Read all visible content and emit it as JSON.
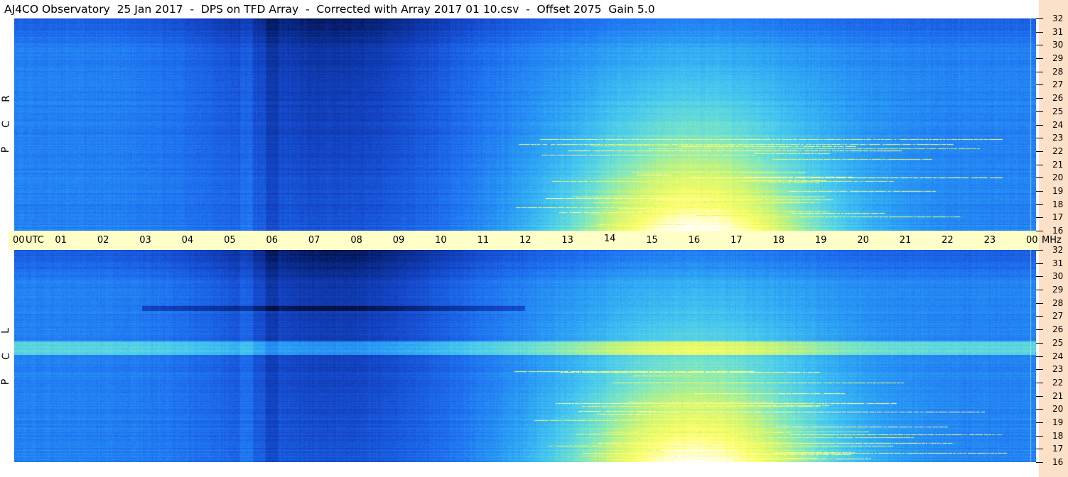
{
  "title": "AJ4CO Observatory  25 Jan 2017  -  DPS on TFD Array  -  Corrected with Array 2017 01 10.csv  -  Offset 2075  Gain 5.0",
  "colors": {
    "time_axis_bg": "#ffffc8",
    "freq_axis_bg": "#fde0c8",
    "colormap": [
      "#000a32",
      "#0a2a8c",
      "#1446c8",
      "#1e6ef0",
      "#2a9ef5",
      "#46c8f0",
      "#78e6c8",
      "#c8f578",
      "#ffff64",
      "#ffffff"
    ]
  },
  "chart_data": [
    {
      "type": "heatmap",
      "title": "",
      "panel_label": "R C P",
      "xlabel": "UTC",
      "ylabel": "MHz",
      "xlim": [
        0,
        24
      ],
      "ylim": [
        16,
        32
      ],
      "x_ticks": [
        "00",
        "01",
        "02",
        "03",
        "04",
        "05",
        "06",
        "07",
        "08",
        "09",
        "10",
        "11",
        "12",
        "13",
        "14",
        "15",
        "16",
        "17",
        "18",
        "19",
        "20",
        "21",
        "22",
        "23",
        "00"
      ],
      "y_ticks": [
        "16",
        "17",
        "18",
        "19",
        "20",
        "21",
        "22",
        "23",
        "24",
        "25",
        "26",
        "27",
        "28",
        "29",
        "30",
        "31",
        "32"
      ],
      "grid": false,
      "colorbar": false
    },
    {
      "type": "heatmap",
      "title": "",
      "panel_label": "L C P",
      "xlabel": "UTC",
      "ylabel": "MHz",
      "xlim": [
        0,
        24
      ],
      "ylim": [
        16,
        32
      ],
      "x_ticks": [
        "00",
        "01",
        "02",
        "03",
        "04",
        "05",
        "06",
        "07",
        "08",
        "09",
        "10",
        "11",
        "12",
        "13",
        "14",
        "15",
        "16",
        "17",
        "18",
        "19",
        "20",
        "21",
        "22",
        "23",
        "00"
      ],
      "y_ticks": [
        "16",
        "17",
        "18",
        "19",
        "20",
        "21",
        "22",
        "23",
        "24",
        "25",
        "26",
        "27",
        "28",
        "29",
        "30",
        "31",
        "32"
      ],
      "grid": false,
      "colorbar": false
    }
  ]
}
